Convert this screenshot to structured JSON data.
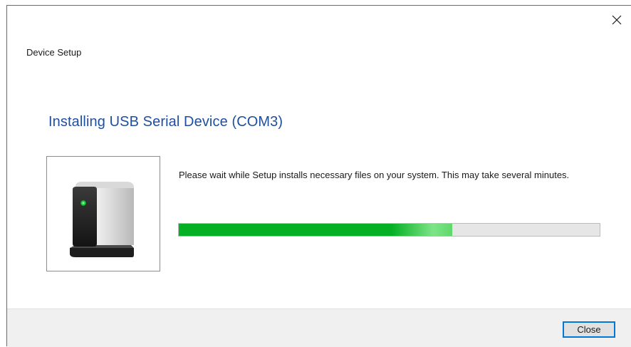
{
  "window": {
    "title": "Device Setup",
    "close_icon": "close-icon"
  },
  "main": {
    "heading": "Installing USB Serial Device (COM3)",
    "device_icon": "usb-device-icon",
    "message": "Please wait while Setup installs necessary files on your system. This may take several minutes.",
    "progress": 0.65,
    "progress_color": "#06b025"
  },
  "footer": {
    "close_label": "Close"
  },
  "colors": {
    "heading": "#1f4fa0",
    "window_border": "#2b78c8",
    "footer_bg": "#f0f0f0"
  }
}
